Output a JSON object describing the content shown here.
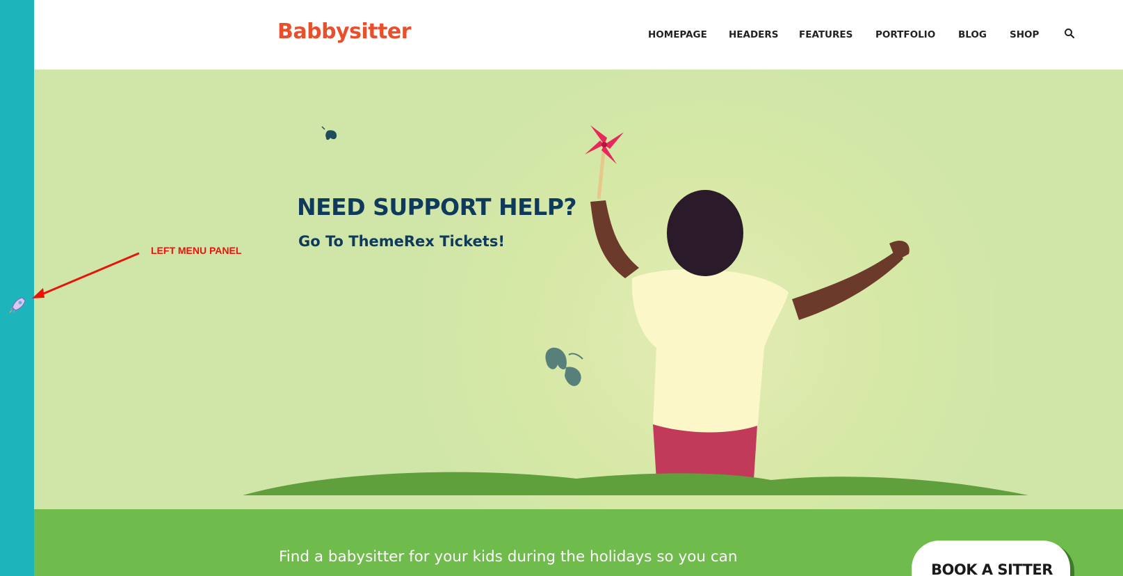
{
  "header": {
    "logo": "Babbysitter",
    "nav": [
      {
        "label": "HOMEPAGE"
      },
      {
        "label": "HEADERS"
      },
      {
        "label": "FEATURES"
      },
      {
        "label": "PORTFOLIO"
      },
      {
        "label": "BLOG"
      },
      {
        "label": "SHOP"
      }
    ],
    "search_icon": "search-icon"
  },
  "side_panel": {
    "icon": "rocket-icon",
    "color": "#1eb4bc"
  },
  "annotation": {
    "label": "LEFT MENU PANEL",
    "color": "#e8140c"
  },
  "hero": {
    "title": "NEED SUPPORT HELP?",
    "subtitle": "Go To ThemeRex Tickets!",
    "background": "#d0e6a8",
    "title_color": "#0f3a5c"
  },
  "band": {
    "text": "Find a babysitter for your kids during the holidays so you can",
    "button": "BOOK A SITTER",
    "color": "#6fbb4c"
  },
  "brand": {
    "logo_color": "#ea4f2c"
  }
}
